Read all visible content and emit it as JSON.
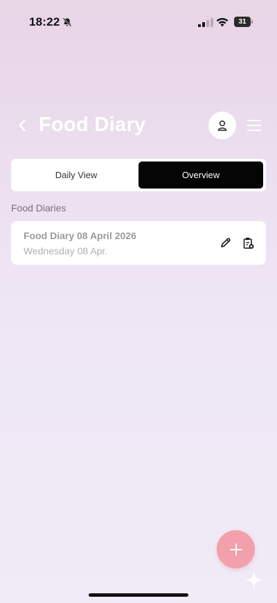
{
  "status_bar": {
    "time": "18:22",
    "battery_level": "31"
  },
  "header": {
    "title": "Food Diary"
  },
  "tabs": [
    {
      "label": "Daily View",
      "active": false
    },
    {
      "label": "Overview",
      "active": true
    }
  ],
  "section": {
    "label": "Food Diaries"
  },
  "diaries": [
    {
      "title": "Food Diary 08 April 2026",
      "subtitle": "Wednesday 08 Apr."
    }
  ],
  "colors": {
    "accent": "#f2a0ab",
    "active_tab": "#050505",
    "title_text": "#ffffff"
  },
  "icons": [
    "bell-slash-icon",
    "cellular-signal-icon",
    "wifi-icon",
    "battery-icon",
    "chevron-left-icon",
    "user-icon",
    "hamburger-menu-icon",
    "pencil-icon",
    "clipboard-delete-icon",
    "plus-icon",
    "sparkle-icon"
  ]
}
